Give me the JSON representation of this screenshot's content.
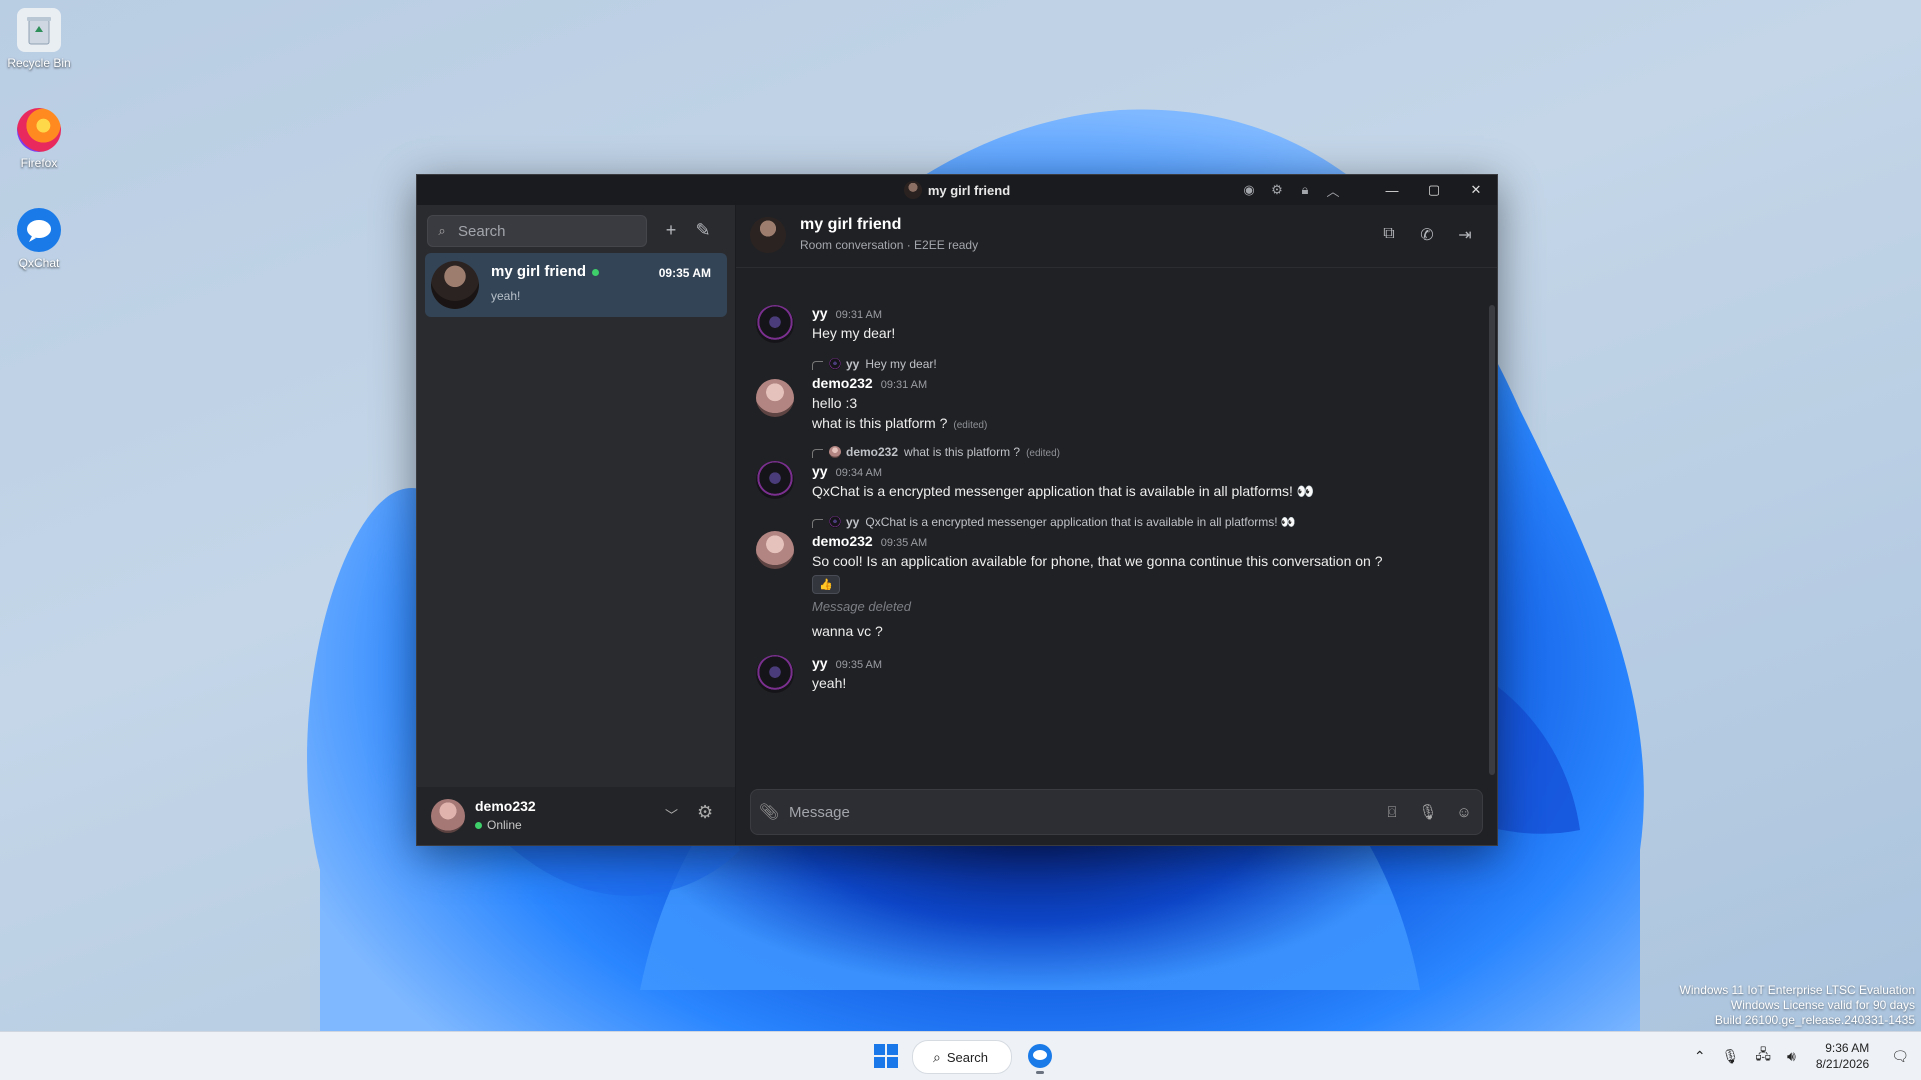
{
  "desktop": {
    "icons": [
      {
        "label": "Recycle Bin",
        "icon": "recycle-bin-icon"
      },
      {
        "label": "Firefox",
        "icon": "firefox-icon"
      },
      {
        "label": "QxChat",
        "icon": "qxchat-icon"
      }
    ],
    "watermark": [
      "Windows 11 IoT Enterprise LTSC Evaluation",
      "Windows License valid for 90 days",
      "Build 26100.ge_release.240331-1435"
    ]
  },
  "taskbar": {
    "search_label": "Search",
    "clock_time": "9:36 AM",
    "clock_date": "8/21/2026"
  },
  "window": {
    "title": "my girl friend",
    "title_icons": [
      "eye-icon",
      "gear-icon",
      "lock-icon",
      "chevron-up-icon"
    ],
    "controls": [
      "minimize",
      "maximize",
      "close"
    ]
  },
  "sidebar": {
    "search_placeholder": "Search",
    "conversations": [
      {
        "name": "my girl friend",
        "time": "09:35 AM",
        "preview": "yeah!",
        "online": true,
        "selected": true
      }
    ],
    "current_user": {
      "name": "demo232",
      "status": "Online"
    }
  },
  "chat": {
    "title": "my girl friend",
    "subtitle": "Room conversation · E2EE ready",
    "header_actions": [
      "popout-icon",
      "phone-icon",
      "leave-icon"
    ],
    "messages": [
      {
        "author": "yy",
        "time": "09:31 AM",
        "lines": [
          "Hey my dear!"
        ]
      },
      {
        "reply_to": {
          "author": "yy",
          "text": "Hey my dear!"
        },
        "author": "demo232",
        "time": "09:31 AM",
        "lines": [
          "hello :3",
          "what is this platform ?"
        ],
        "edited_tag": "(edited)"
      },
      {
        "reply_to": {
          "author": "demo232",
          "text": "what is this platform ?",
          "edited_tag": "(edited)"
        },
        "author": "yy",
        "time": "09:34 AM",
        "lines": [
          "QxChat is a encrypted messenger application that is available in all platforms! 👀"
        ]
      },
      {
        "reply_to": {
          "author": "yy",
          "text": "QxChat is a encrypted messenger application that is available in all platforms! 👀"
        },
        "author": "demo232",
        "time": "09:35 AM",
        "lines": [
          "So cool! Is an application available for phone, that we gonna continue this conversation on ?"
        ],
        "reaction": "👍",
        "deleted_note": "Message deleted",
        "followup": "wanna vc ?"
      },
      {
        "author": "yy",
        "time": "09:35 AM",
        "lines": [
          "yeah!"
        ]
      }
    ],
    "composer_placeholder": "Message"
  }
}
